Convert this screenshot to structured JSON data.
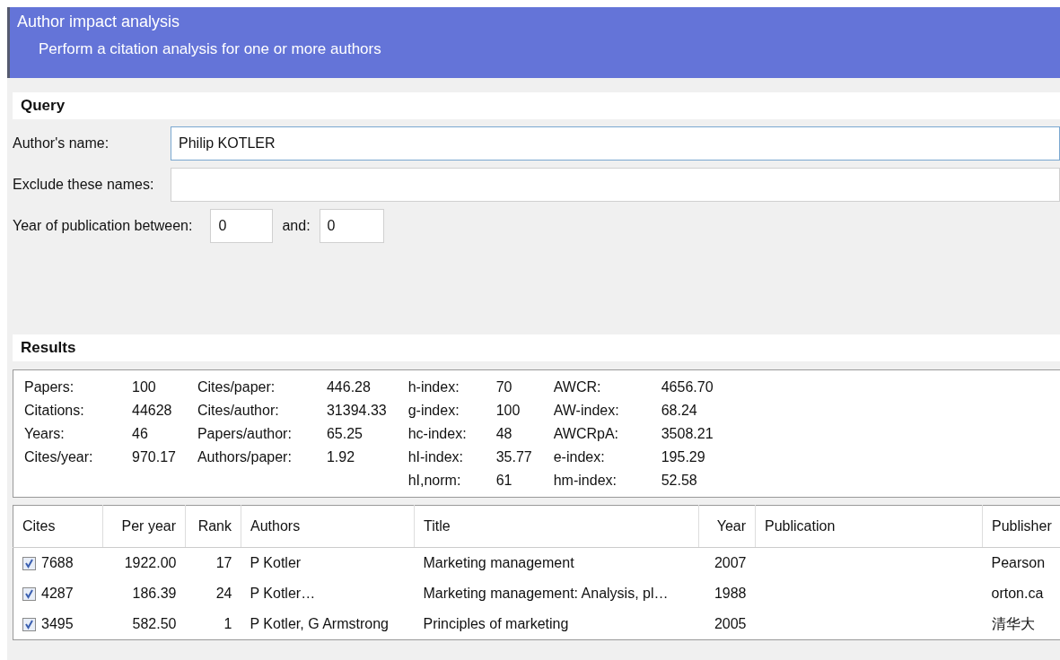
{
  "header": {
    "title": "Author impact analysis",
    "subtitle": "Perform a citation analysis for one or more authors"
  },
  "query": {
    "title": "Query",
    "author": {
      "label": "Author's name:",
      "value": "Philip KOTLER"
    },
    "exclude": {
      "label": "Exclude these names:"
    },
    "years": {
      "label": "Year of publication between:",
      "from": "0",
      "and_label": "and:",
      "to": "0"
    }
  },
  "results": {
    "title": "Results",
    "metric_columns": [
      [
        {
          "label": "Papers:",
          "value": "100"
        },
        {
          "label": "Citations:",
          "value": "44628"
        },
        {
          "label": "Years:",
          "value": "46"
        },
        {
          "label": "Cites/year:",
          "value": "970.17"
        }
      ],
      [
        {
          "label": "Cites/paper:",
          "value": "446.28"
        },
        {
          "label": "Cites/author:",
          "value": "31394.33"
        },
        {
          "label": "Papers/author:",
          "value": "65.25"
        },
        {
          "label": "Authors/paper:",
          "value": "1.92"
        }
      ],
      [
        {
          "label": "h-index:",
          "value": "70"
        },
        {
          "label": "g-index:",
          "value": "100"
        },
        {
          "label": "hc-index:",
          "value": "48"
        },
        {
          "label": "hI-index:",
          "value": "35.77"
        },
        {
          "label": "hI,norm:",
          "value": "61"
        }
      ],
      [
        {
          "label": "AWCR:",
          "value": "4656.70"
        },
        {
          "label": "AW-index:",
          "value": "68.24"
        },
        {
          "label": "AWCRpA:",
          "value": "3508.21"
        },
        {
          "label": "e-index:",
          "value": "195.29"
        },
        {
          "label": "hm-index:",
          "value": "52.58"
        }
      ]
    ]
  },
  "table": {
    "columns": [
      "Cites",
      "Per year",
      "Rank",
      "Authors",
      "Title",
      "Year",
      "Publication",
      "Publisher"
    ],
    "rows": [
      {
        "checked": true,
        "cites": "7688",
        "per_year": "1922.00",
        "rank": "17",
        "authors": "P Kotler",
        "title": "Marketing management",
        "year": "2007",
        "publisher": "Pearson"
      },
      {
        "checked": true,
        "cites": "4287",
        "per_year": "186.39",
        "rank": "24",
        "authors": "P Kotler…",
        "title": "Marketing management: Analysis, pl…",
        "year": "1988",
        "publisher": "orton.ca"
      },
      {
        "checked": true,
        "cites": "3495",
        "per_year": "582.50",
        "rank": "1",
        "authors": "P Kotler, G Armstrong",
        "title": "Principles of marketing",
        "year": "2005",
        "publisher": "清华大"
      }
    ]
  }
}
